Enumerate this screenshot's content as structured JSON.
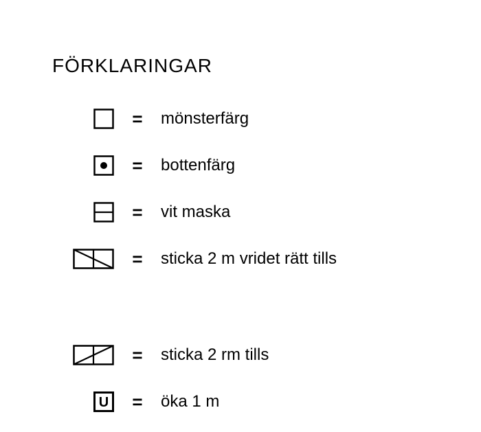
{
  "title": "FÖRKLARINGAR",
  "eq": "=",
  "rows": {
    "r1": {
      "icon": "empty-square-icon",
      "label": "mönsterfärg"
    },
    "r2": {
      "icon": "dot-square-icon",
      "label": "bottenfärg"
    },
    "r3": {
      "icon": "midline-square-icon",
      "label": "vit maska"
    },
    "r4": {
      "icon": "backslash-double-icon",
      "label": "sticka 2 m vridet rätt tills"
    },
    "r5": {
      "icon": "slash-double-icon",
      "label": "sticka 2 rm tills"
    },
    "r6": {
      "icon": "u-square-icon",
      "label": "öka 1 m"
    }
  }
}
